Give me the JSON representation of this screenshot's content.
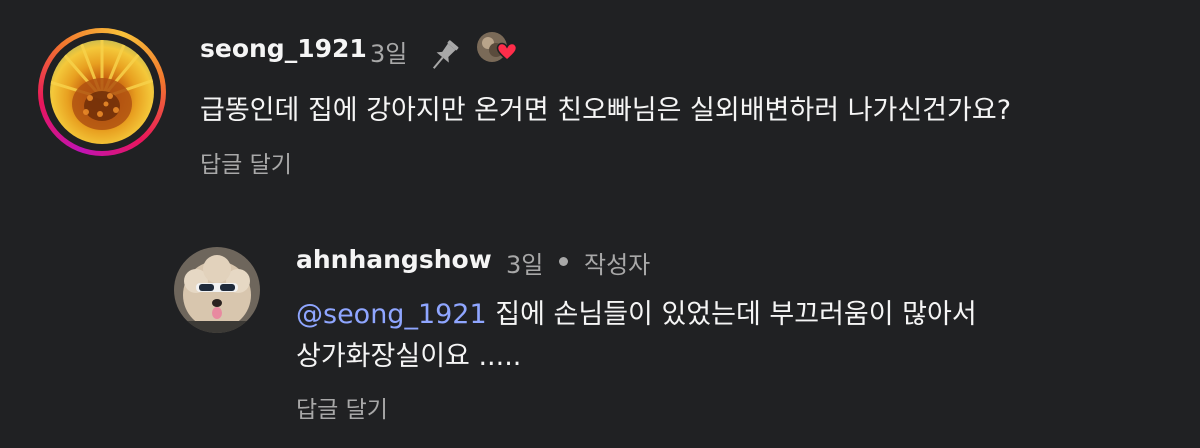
{
  "comment": {
    "username": "seong_1921",
    "time": "3일",
    "pinned_icon": "pin-icon",
    "liked_by_creator_icon": "creator-heart-icon",
    "text": "급똥인데 집에 강아지만 온거면 친오빠님은 실외배변하러 나가신건가요?",
    "reply_label": "답글 달기"
  },
  "reply": {
    "username": "ahnhangshow",
    "time": "3일",
    "author_badge": "작성자",
    "mention": "@seong_1921",
    "text_line1_rest": " 집에 손님들이 있었는데 부끄러움이 많아서",
    "text_line2": "상가화장실이요 .....",
    "reply_label": "답글 달기"
  },
  "colors": {
    "background": "#202123",
    "primary_text": "#f5f5f5",
    "secondary_text": "#a8a8a8",
    "mention": "#8fa6ff",
    "heart": "#ff2d4a"
  }
}
